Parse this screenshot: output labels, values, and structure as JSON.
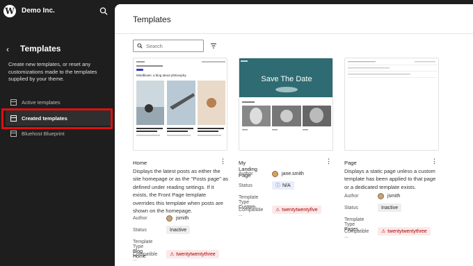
{
  "site": {
    "name": "Demo Inc."
  },
  "sidebar": {
    "title": "Templates",
    "description": "Create new templates, or reset any customizations made to the templates supplied by your theme.",
    "items": [
      {
        "label": "Active templates"
      },
      {
        "label": "Created templates"
      },
      {
        "label": "Bluehost Blueprint"
      }
    ]
  },
  "main": {
    "title": "Templates",
    "search_placeholder": "Search"
  },
  "labels": {
    "author": "Author",
    "status": "Status",
    "template_type": "Template Type",
    "compatible": "Compatible ..."
  },
  "cards": [
    {
      "title": "Home",
      "description": "Displays the latest posts as either the site homepage or as the \"Posts page\" as defined under reading settings. If it exists, the Front Page template overrides this template when posts are shown on the homepage.",
      "author": "jsmith",
      "status": "Inactive",
      "template_type": "Blog Home",
      "compatible": "twentytwentythree",
      "thumb_heading": "Mindblown: a blog about philosophy."
    },
    {
      "title": "My Landing Page",
      "author": "jane.smith",
      "status": "N/A",
      "template_type": "Custom",
      "compatible": "twentytwentyfive",
      "thumb_heading": "Save The Date"
    },
    {
      "title": "Page",
      "description": "Displays a static page unless a custom template has been applied to that page or a dedicated template exists.",
      "author": "jsmith",
      "status": "Inactive",
      "template_type": "Pages",
      "compatible": "twentytwentythree"
    }
  ],
  "colors": {
    "sidebar_bg": "#1e1e1e",
    "highlight": "#dd1111",
    "warning": "#aa0000"
  }
}
